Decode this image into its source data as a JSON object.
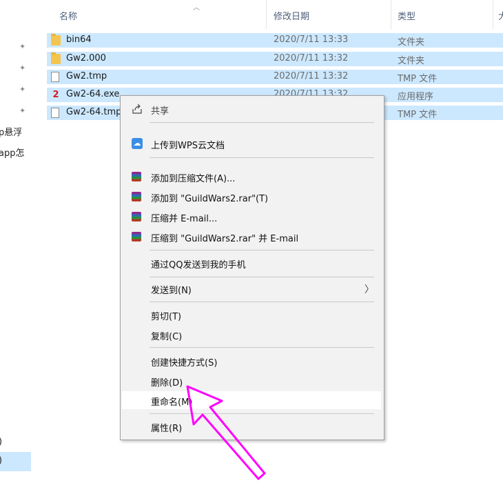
{
  "nav": {
    "pins": [
      "pin",
      "pin",
      "pin",
      "pin"
    ],
    "items": [
      "p悬浮",
      "app怎"
    ],
    "bottom_items": [
      ")",
      ")"
    ]
  },
  "header": {
    "col_name": "名称",
    "col_date": "修改日期",
    "col_type": "类型",
    "col_size": "大"
  },
  "files": [
    {
      "name": "bin64",
      "date": "2020/7/11 13:33",
      "type": "文件夹",
      "icon": "folder-icon"
    },
    {
      "name": "Gw2.000",
      "date": "2020/7/11 13:32",
      "type": "文件夹",
      "icon": "folder-icon"
    },
    {
      "name": "Gw2.tmp",
      "date": "2020/7/11 13:32",
      "type": "TMP 文件",
      "icon": "file-icon"
    },
    {
      "name": "Gw2-64.exe",
      "date": "2020/7/11 13:32",
      "type": "应用程序",
      "icon": "exe-icon"
    },
    {
      "name": "Gw2-64.tmp",
      "date": "",
      "type": "TMP 文件",
      "icon": "file-icon"
    }
  ],
  "menu": {
    "share": "共享",
    "upload_wps": "上传到WPS云文档",
    "add_archive": "添加到压缩文件(A)...",
    "add_to_rar": "添加到 \"GuildWars2.rar\"(T)",
    "compress_email": "压缩并 E-mail...",
    "compress_rar_email": "压缩到 \"GuildWars2.rar\" 并 E-mail",
    "send_qq": "通过QQ发送到我的手机",
    "send_to": "发送到(N)",
    "cut": "剪切(T)",
    "copy": "复制(C)",
    "shortcut": "创建快捷方式(S)",
    "delete": "删除(D)",
    "rename": "重命名(M)",
    "properties": "属性(R)"
  },
  "colors": {
    "selection": "#cce8ff",
    "menu_bg": "#f2f2f2",
    "arrow": "#ff00ff"
  }
}
